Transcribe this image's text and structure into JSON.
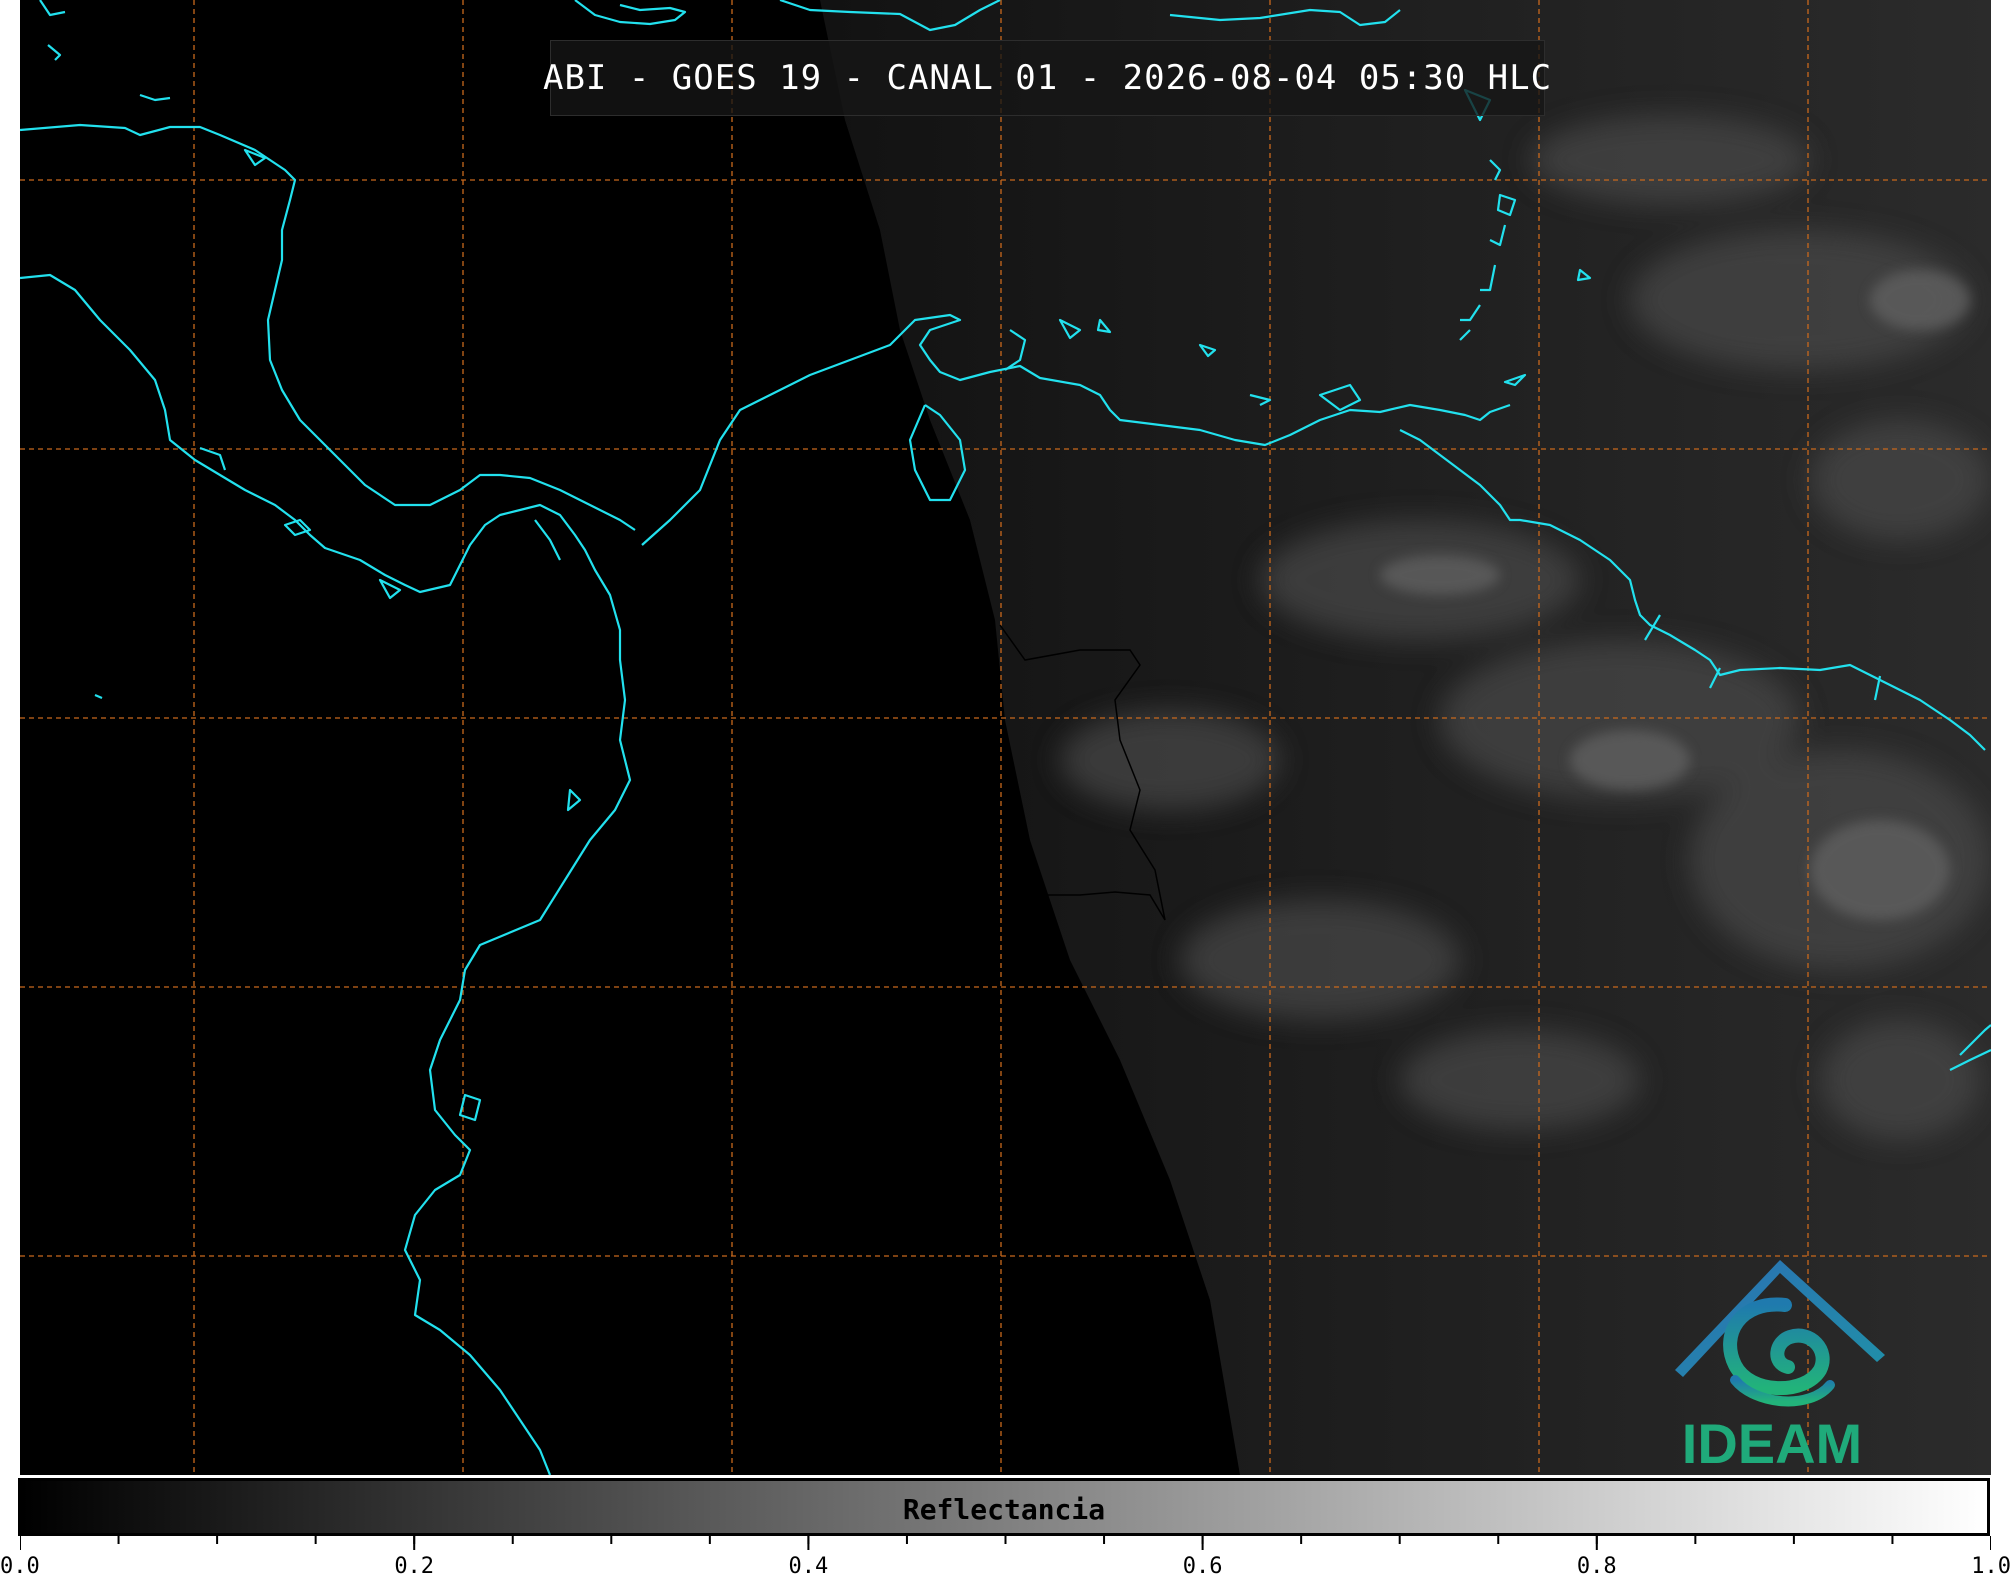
{
  "title": "ABI - GOES 19 - CANAL 01 - 2026-08-04 05:30 HLC",
  "logo": {
    "text": "IDEAM",
    "colors": {
      "roof": "#2b6fb3",
      "swirl": "#1ea58c",
      "text": "#1faa7a"
    }
  },
  "colors": {
    "coastline": "#22e1ee",
    "grid": "#c8681c",
    "border": "#000000"
  },
  "colorbar": {
    "label": "Reflectancia",
    "range": [
      0.0,
      1.0
    ],
    "colormap": "grayscale",
    "tick_labels": [
      "0.0",
      "0.2",
      "0.4",
      "0.6",
      "0.8",
      "1.0"
    ],
    "tick_values": [
      0.0,
      0.2,
      0.4,
      0.6,
      0.8,
      1.0
    ]
  },
  "map": {
    "graticule": "dashed",
    "night_side": "left",
    "day_side": "right"
  }
}
